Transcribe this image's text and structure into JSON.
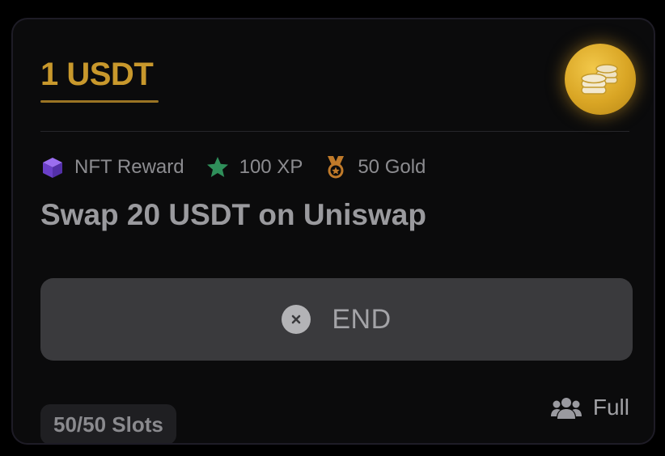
{
  "card": {
    "reward_amount": "1 USDT",
    "coin_icon": "coins-icon",
    "tags": [
      {
        "icon": "cube-icon",
        "label": "NFT Reward",
        "color": "#7b4fd6"
      },
      {
        "icon": "star-icon",
        "label": "100 XP",
        "color": "#2f8f5a"
      },
      {
        "icon": "medal-icon",
        "label": "50 Gold",
        "color": "#c07a2a"
      }
    ],
    "title": "Swap 20 USDT on Uniswap",
    "end_button": {
      "icon": "close-circle-icon",
      "label": "END"
    },
    "slots": "50/50 Slots",
    "status": {
      "icon": "users-icon",
      "label": "Full"
    }
  },
  "colors": {
    "accent_gold": "#c8982c",
    "button_bg": "#3a3a3d",
    "card_bg": "#0b0b0c"
  }
}
